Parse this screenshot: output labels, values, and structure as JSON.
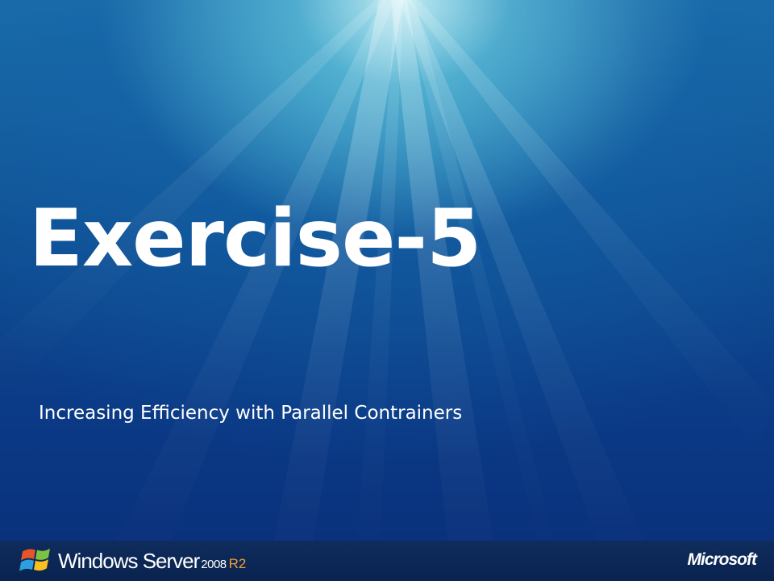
{
  "slide": {
    "title": "Exercise-5",
    "subtitle": "Increasing Efficiency with Parallel Contrainers"
  },
  "footer": {
    "product_name": "Windows Server",
    "product_version": "2008",
    "product_edition": "R2",
    "company_logo": "Microsoft"
  },
  "colors": {
    "background_top": "#1a6ea8",
    "background_bottom": "#0a2f79",
    "footer": "#0e2c5c",
    "text": "#ffffff",
    "edition_accent": "#f0a030"
  },
  "icons": {
    "product_logo": "windows-flag-icon"
  }
}
